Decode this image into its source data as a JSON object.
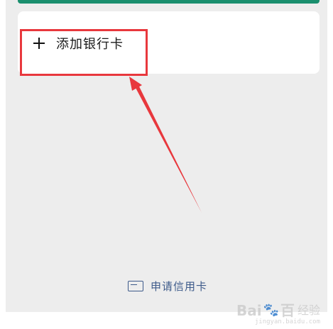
{
  "add_bank_card": {
    "label": "添加银行卡",
    "icon": "plus-icon"
  },
  "apply_credit_card": {
    "label": "申请信用卡",
    "icon": "credit-card-icon"
  },
  "watermark": {
    "logo": "Bai",
    "logo_suffix": "百",
    "suffix": "经验",
    "url": "jingyan.baidu.com"
  },
  "colors": {
    "accent_green": "#1a8f6e",
    "annotation_red": "#e8383d",
    "link_blue": "#3d5a8a",
    "background": "#ededed"
  }
}
